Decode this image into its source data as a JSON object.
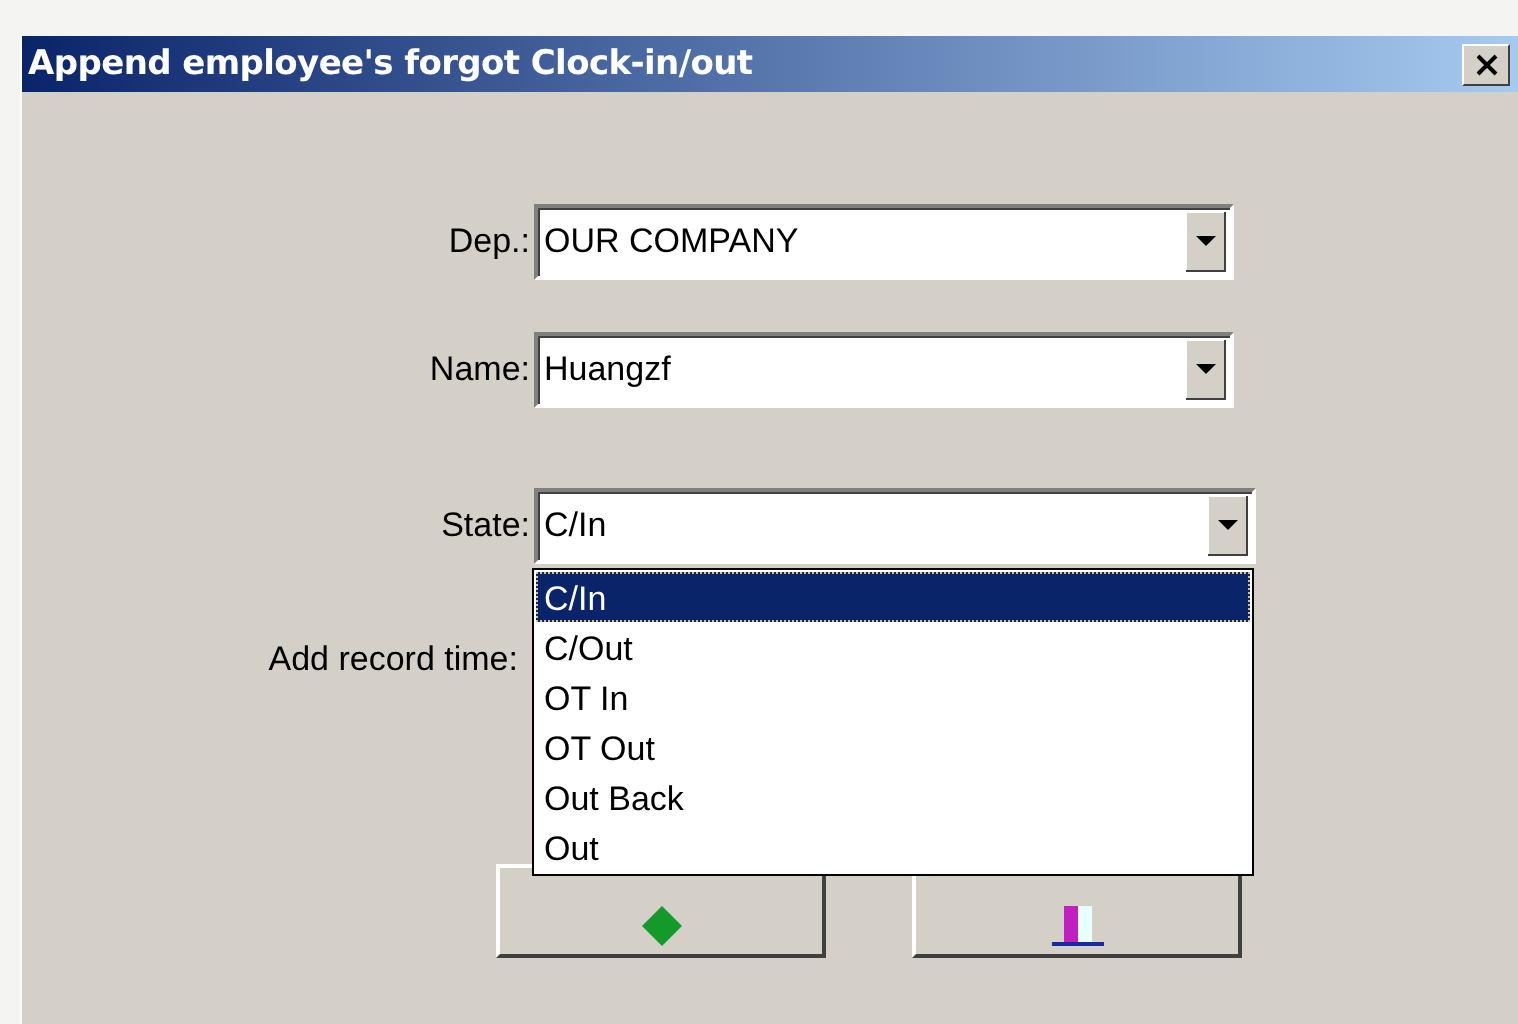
{
  "window": {
    "title": "Append employee's forgot Clock-in/out"
  },
  "fields": [
    {
      "label": "Dep.:",
      "value": "OUR COMPANY"
    },
    {
      "label": "Name:",
      "value": "Huangzf"
    },
    {
      "label": "State:",
      "value": "C/In",
      "expanded": true,
      "options": [
        {
          "label": "C/In",
          "selected": true
        },
        {
          "label": "C/Out",
          "selected": false
        },
        {
          "label": "OT In",
          "selected": false
        },
        {
          "label": "OT Out",
          "selected": false
        },
        {
          "label": "Out Back",
          "selected": false
        },
        {
          "label": "Out",
          "selected": false
        }
      ]
    }
  ],
  "time_label": "Add record time:",
  "buttons": [
    {
      "kind": "append"
    },
    {
      "kind": "close"
    }
  ]
}
